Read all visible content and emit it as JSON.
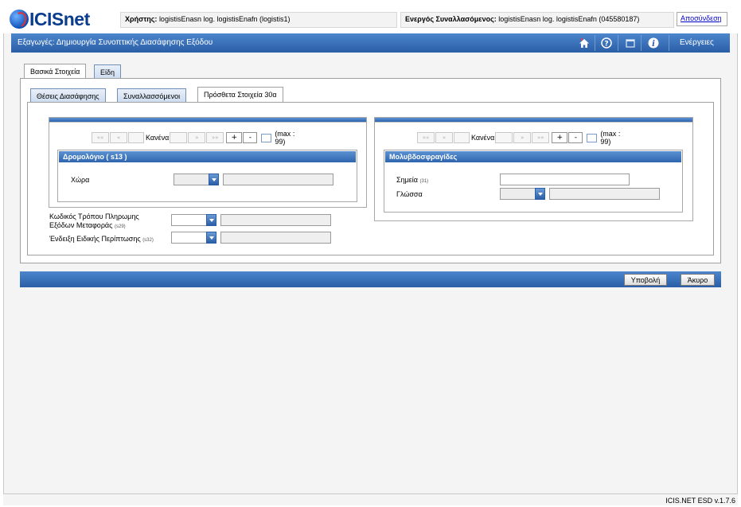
{
  "header": {
    "logo_text": "ICISnet",
    "user_label": "Χρήστης:",
    "user_value": "logistisEnasn log. logistisEnafn (logistis1)",
    "trader_label": "Ενεργός Συναλλασόμενος:",
    "trader_value": "logistisEnasn log. logistisEnafn (045580187)",
    "logout": "Αποσύνδεση"
  },
  "titlebar": {
    "title": "Εξαγωγές: Δημιουργία Συνοπτικής Διασάφησης Εξόδου",
    "actions": "Ενέργειες",
    "icons": [
      "home-icon",
      "help-icon",
      "window-icon",
      "info-icon"
    ]
  },
  "tabs": {
    "main": [
      "Βασικά Στοιχεία",
      "Είδη"
    ],
    "sub": [
      "Θέσεις Διασάφησης",
      "Συναλλασσόμενοι",
      "Πρόσθετα Στοιχεία 30α"
    ]
  },
  "left_panel": {
    "pager": {
      "first": "««",
      "prev": "«",
      "current": "Κανένα",
      "next": "»",
      "last": "»»",
      "add": "+",
      "remove": "-",
      "max": "(max : 99)"
    },
    "section_title": "Δρομολόγιο ( s13 )",
    "country_label": "Χώρα"
  },
  "right_panel": {
    "pager": {
      "first": "««",
      "prev": "«",
      "current": "Κανένα",
      "next": "»",
      "last": "»»",
      "add": "+",
      "remove": "-",
      "max": "(max : 99)"
    },
    "section_title": "Μολυβδοσφραγίδες",
    "seals_label": "Σημεία",
    "seals_code": "(31)",
    "language_label": "Γλώσσα"
  },
  "fields": {
    "payment_label_1": "Κωδικός Τρόπου Πληρωμης",
    "payment_label_2": "Εξόδων Μεταφοράς",
    "payment_code": "(s29)",
    "special_label": "Ένδειξη Ειδικής Περίπτωσης",
    "special_code": "(s32)"
  },
  "buttons": {
    "submit": "Υποβολή",
    "cancel": "Άκυρο"
  },
  "footer": {
    "version": "ICIS.NET ESD v.1.7.6"
  }
}
